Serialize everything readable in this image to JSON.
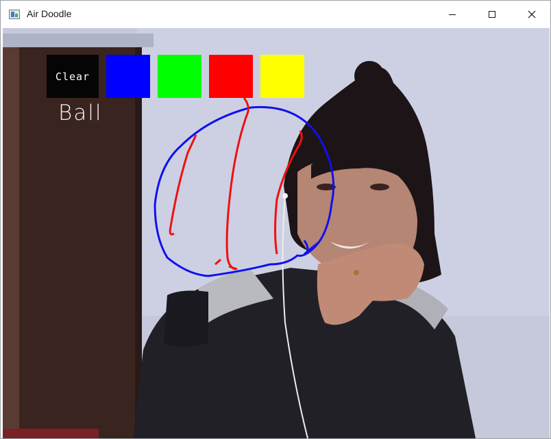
{
  "window": {
    "title": "Air Doodle"
  },
  "toolbar": {
    "clear_label": "Clear",
    "colors": [
      {
        "name": "blue",
        "hex": "#0000ff"
      },
      {
        "name": "green",
        "hex": "#00ff00"
      },
      {
        "name": "red",
        "hex": "#ff0000"
      },
      {
        "name": "yellow",
        "hex": "#ffff00"
      }
    ]
  },
  "canvas": {
    "mode_label": "Ball",
    "stroke_colors": [
      "#1010ee",
      "#ee1010"
    ]
  }
}
